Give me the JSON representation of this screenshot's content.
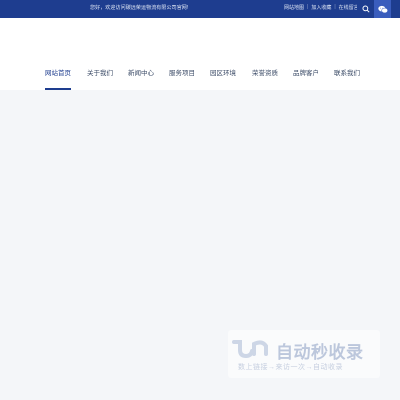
{
  "topbar": {
    "welcome": "您好，欢迎访问碳远荣运物流有限公司官网!",
    "links": [
      "网站地图",
      "加入收藏",
      "在线留言"
    ],
    "icons": [
      "search-icon",
      "wechat-icon"
    ]
  },
  "nav": {
    "items": [
      "网站首页",
      "关于我们",
      "新闻中心",
      "服务项目",
      "园区环境",
      "荣誉资质",
      "品牌客户",
      "联系我们"
    ],
    "active_index": 0
  },
  "watermark": {
    "title": "自动秒收录",
    "subtitle": "数上链接→来访一次→自动收录"
  },
  "colors": {
    "brand": "#1e3d8f",
    "background": "#f4f6f9"
  }
}
